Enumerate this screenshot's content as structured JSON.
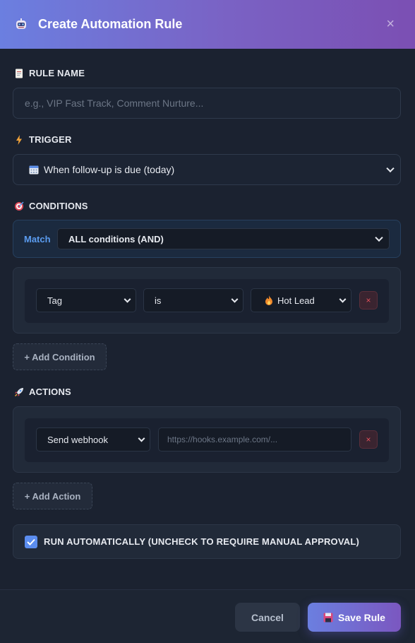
{
  "header": {
    "title": "Create Automation Rule",
    "close": "×"
  },
  "rule_name": {
    "label": "RULE NAME",
    "placeholder": "e.g., VIP Fast Track, Comment Nurture..."
  },
  "trigger": {
    "label": "TRIGGER",
    "selected": "When follow-up is due (today)"
  },
  "conditions": {
    "label": "CONDITIONS",
    "match_label": "Match",
    "match_selected": "ALL conditions (AND)",
    "rows": [
      {
        "field": "Tag",
        "operator": "is",
        "value": "Hot Lead"
      }
    ],
    "delete": "×",
    "add_label": "+ Add Condition"
  },
  "actions": {
    "label": "ACTIONS",
    "rows": [
      {
        "type": "Send webhook",
        "url_placeholder": "https://hooks.example.com/..."
      }
    ],
    "delete": "×",
    "add_label": "+ Add Action"
  },
  "auto_run": {
    "checked": true,
    "label": "RUN AUTOMATICALLY (UNCHECK TO REQUIRE MANUAL APPROVAL)"
  },
  "footer": {
    "cancel_label": "Cancel",
    "save_label": "Save Rule"
  },
  "colors": {
    "accent_start": "#6b7fe0",
    "accent_end": "#7b4fb3",
    "match_blue": "#5b9cf0",
    "danger": "#e0505a"
  }
}
